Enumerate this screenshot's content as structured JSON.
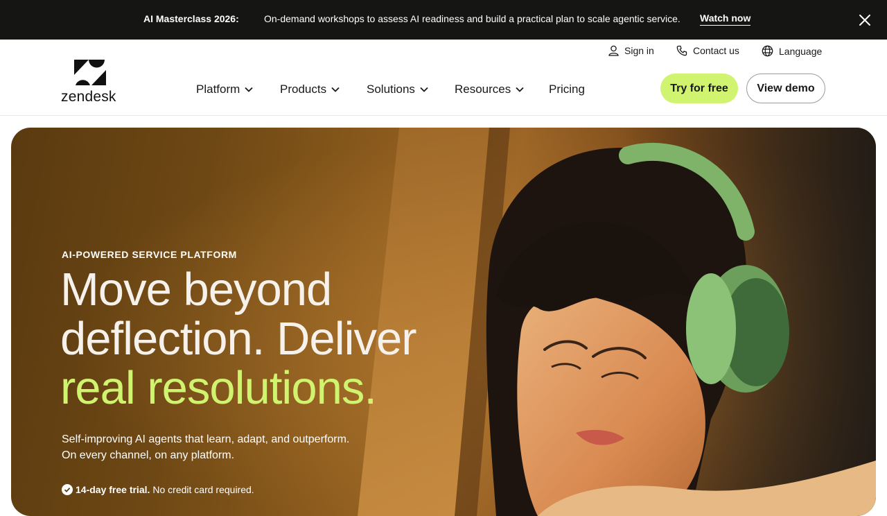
{
  "announcement": {
    "title": "AI Masterclass 2026:",
    "text": "On-demand workshops to assess AI readiness and build a practical plan to scale agentic service.",
    "link_label": "Watch now"
  },
  "brand": {
    "wordmark": "zendesk"
  },
  "utility_nav": {
    "sign_in": "Sign in",
    "contact_us": "Contact us",
    "language": "Language"
  },
  "main_nav": {
    "items": [
      {
        "label": "Platform"
      },
      {
        "label": "Products"
      },
      {
        "label": "Solutions"
      },
      {
        "label": "Resources"
      },
      {
        "label": "Pricing"
      }
    ]
  },
  "cta": {
    "try_label": "Try for free",
    "demo_label": "View demo"
  },
  "hero": {
    "eyebrow": "AI-POWERED SERVICE PLATFORM",
    "headline_line1": "Move beyond",
    "headline_line2": "deflection. Deliver",
    "headline_accent": "real resolutions.",
    "sub_line1": "Self-improving AI agents that learn, adapt, and outperform.",
    "sub_line2": "On every channel, on any platform.",
    "trial_bold": "14-day free trial.",
    "trial_text": "No credit card required."
  },
  "colors": {
    "announcement_bg": "#151614",
    "accent_lime": "#d1f470",
    "text_dark": "#17181a"
  },
  "icons": [
    "close-icon",
    "zendesk-logo",
    "user-icon",
    "phone-icon",
    "globe-icon",
    "chevron-down-icon",
    "check-circle-icon"
  ]
}
